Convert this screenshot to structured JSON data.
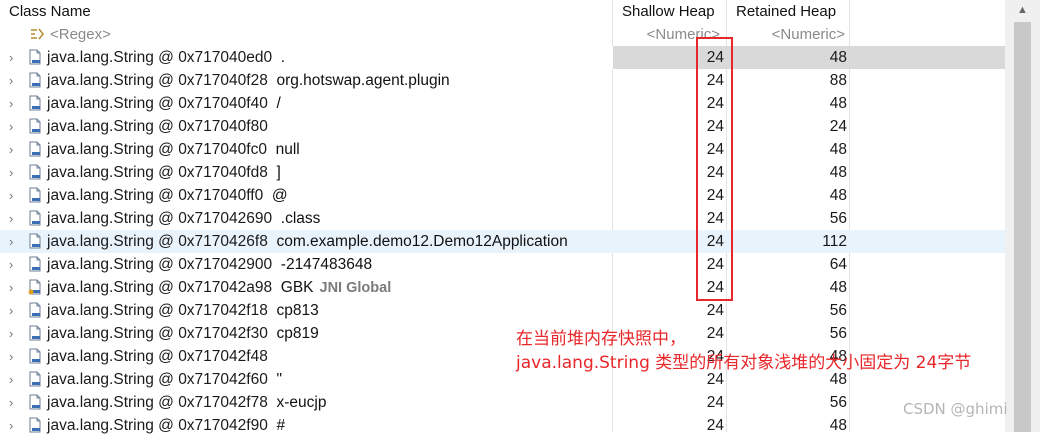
{
  "columns": {
    "class_name": "Class Name",
    "shallow_heap": "Shallow Heap",
    "retained_heap": "Retained Heap"
  },
  "filter": {
    "regex": "<Regex>",
    "shallow_numeric": "<Numeric>",
    "retained_numeric": "<Numeric>"
  },
  "rows": [
    {
      "address": "java.lang.String @ 0x717040ed0",
      "value": ".",
      "shallow": "24",
      "retained": "48"
    },
    {
      "address": "java.lang.String @ 0x717040f28",
      "value": "org.hotswap.agent.plugin",
      "shallow": "24",
      "retained": "88"
    },
    {
      "address": "java.lang.String @ 0x717040f40",
      "value": "/",
      "shallow": "24",
      "retained": "48"
    },
    {
      "address": "java.lang.String @ 0x717040f80",
      "value": "",
      "shallow": "24",
      "retained": "24"
    },
    {
      "address": "java.lang.String @ 0x717040fc0",
      "value": "null",
      "shallow": "24",
      "retained": "48"
    },
    {
      "address": "java.lang.String @ 0x717040fd8",
      "value": "]",
      "shallow": "24",
      "retained": "48"
    },
    {
      "address": "java.lang.String @ 0x717040ff0",
      "value": "@",
      "shallow": "24",
      "retained": "48"
    },
    {
      "address": "java.lang.String @ 0x717042690",
      "value": ".class",
      "shallow": "24",
      "retained": "56"
    },
    {
      "address": "java.lang.String @ 0x7170426f8",
      "value": "com.example.demo12.Demo12Application",
      "shallow": "24",
      "retained": "112"
    },
    {
      "address": "java.lang.String @ 0x717042900",
      "value": "-2147483648",
      "shallow": "24",
      "retained": "64"
    },
    {
      "address": "java.lang.String @ 0x717042a98",
      "value": "GBK",
      "tag": "JNI Global",
      "shallow": "24",
      "retained": "48"
    },
    {
      "address": "java.lang.String @ 0x717042f18",
      "value": "cp813",
      "shallow": "24",
      "retained": "56"
    },
    {
      "address": "java.lang.String @ 0x717042f30",
      "value": "cp819",
      "shallow": "24",
      "retained": "56"
    },
    {
      "address": "java.lang.String @ 0x717042f48",
      "value": "",
      "shallow": "24",
      "retained": "48"
    },
    {
      "address": "java.lang.String @ 0x717042f60",
      "value": "\"",
      "shallow": "24",
      "retained": "48"
    },
    {
      "address": "java.lang.String @ 0x717042f78",
      "value": "x-eucjp",
      "shallow": "24",
      "retained": "56"
    },
    {
      "address": "java.lang.String @ 0x717042f90",
      "value": "#",
      "shallow": "24",
      "retained": "48"
    }
  ],
  "annotation": {
    "line1": "在当前堆内存快照中，",
    "line2": "java.lang.String 类型的所有对象浅堆的大小固定为 24字节"
  },
  "watermark": "CSDN @ghimi",
  "colors": {
    "annotation_red": "#e8272a",
    "selected_row": "#d9d9d9",
    "hover_row": "#e9f3fc"
  }
}
